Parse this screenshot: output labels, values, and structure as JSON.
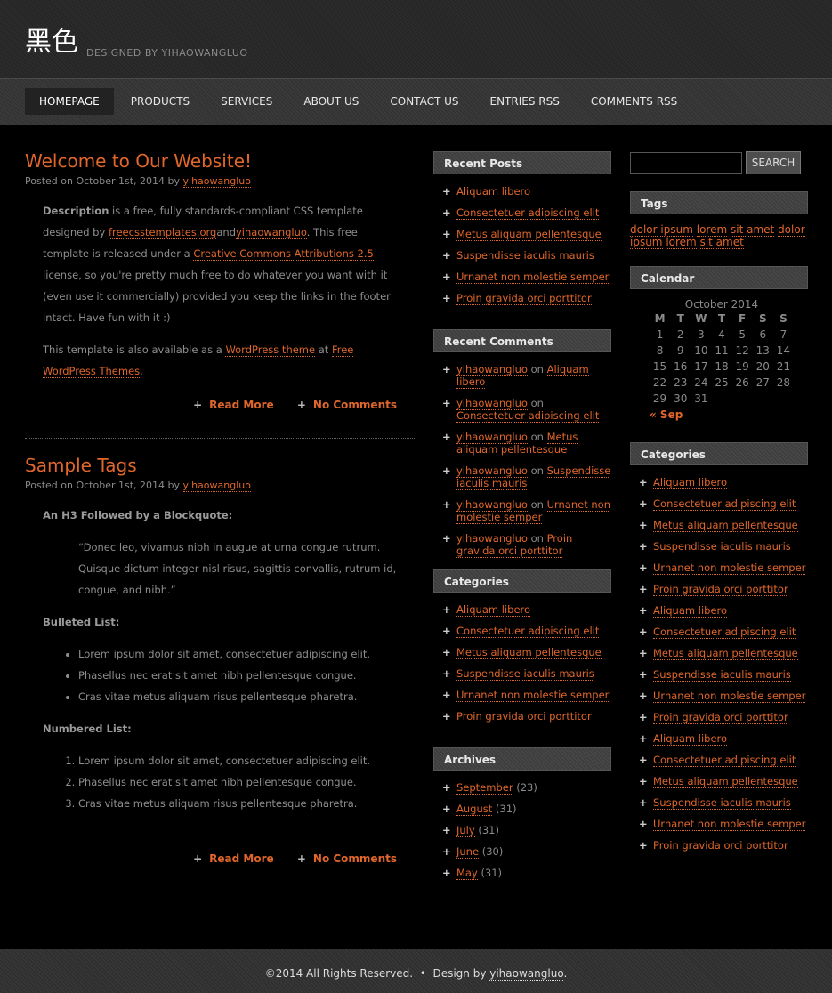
{
  "header": {
    "title": "黑色",
    "tagline": "DESIGNED BY YIHAOWANGLUO"
  },
  "menu": [
    {
      "label": "HOMEPAGE"
    },
    {
      "label": "PRODUCTS"
    },
    {
      "label": "SERVICES"
    },
    {
      "label": "ABOUT US"
    },
    {
      "label": "CONTACT US"
    },
    {
      "label": "ENTRIES RSS"
    },
    {
      "label": "COMMENTS RSS"
    }
  ],
  "posts": [
    {
      "title": "Welcome to Our Website!",
      "byline_prefix": "Posted on October 1st, 2014 by ",
      "author": "yihaowangluo",
      "p1": {
        "strong": "Description",
        "t1": " is a free, fully standards-compliant CSS template designed by ",
        "link1": "freecsstemplates.org",
        "t2": "and",
        "link2": "yihaowangluo",
        "t3": ". This free template is released under a ",
        "link3": "Creative Commons Attributions 2.5",
        "t4": " license, so you're pretty much free to do whatever you want with it (even use it commercially) provided you keep the links in the footer intact. Have fun with it :)"
      },
      "p2": {
        "t1": "This template is also available as a ",
        "link1": "WordPress theme",
        "t2": " at ",
        "link2": "Free WordPress Themes",
        "t3": "."
      },
      "read_more": "Read More",
      "comments": "No Comments"
    },
    {
      "title": "Sample Tags",
      "byline_prefix": "Posted on October 1st, 2014 by ",
      "author": "yihaowangluo",
      "h3_blockquote": "An H3 Followed by a Blockquote:",
      "blockquote": "“Donec leo, vivamus nibh in augue at urna congue rutrum. Quisque dictum integer nisl risus, sagittis convallis, rutrum id, congue, and nibh.”",
      "h3_bulleted": "Bulleted List:",
      "bulleted": [
        "Lorem ipsum dolor sit amet, consectetuer adipiscing elit.",
        "Phasellus nec erat sit amet nibh pellentesque congue.",
        "Cras vitae metus aliquam risus pellentesque pharetra."
      ],
      "h3_numbered": "Numbered List:",
      "numbered": [
        "Lorem ipsum dolor sit amet, consectetuer adipiscing elit.",
        "Phasellus nec erat sit amet nibh pellentesque congue.",
        "Cras vitae metus aliquam risus pellentesque pharetra."
      ],
      "read_more": "Read More",
      "comments": "No Comments"
    }
  ],
  "recent_posts": {
    "title": "Recent Posts",
    "items": [
      "Aliquam libero",
      "Consectetuer adipiscing elit",
      "Metus aliquam pellentesque",
      "Suspendisse iaculis mauris",
      "Urnanet non molestie semper",
      "Proin gravida orci porttitor"
    ]
  },
  "recent_comments": {
    "title": "Recent Comments",
    "on": "on",
    "items": [
      {
        "author": "yihaowangluo",
        "post": "Aliquam libero"
      },
      {
        "author": "yihaowangluo",
        "post": "Consectetuer adipiscing elit"
      },
      {
        "author": "yihaowangluo",
        "post": "Metus aliquam pellentesque"
      },
      {
        "author": "yihaowangluo",
        "post": "Suspendisse iaculis mauris"
      },
      {
        "author": "yihaowangluo",
        "post": "Urnanet non molestie semper"
      },
      {
        "author": "yihaowangluo",
        "post": "Proin gravida orci porttitor"
      }
    ]
  },
  "categories_mid": {
    "title": "Categories",
    "items": [
      "Aliquam libero",
      "Consectetuer adipiscing elit",
      "Metus aliquam pellentesque",
      "Suspendisse iaculis mauris",
      "Urnanet non molestie semper",
      "Proin gravida orci porttitor"
    ]
  },
  "archives": {
    "title": "Archives",
    "items": [
      {
        "month": "September",
        "count": "(23)"
      },
      {
        "month": "August",
        "count": "(31)"
      },
      {
        "month": "July",
        "count": "(31)"
      },
      {
        "month": "June",
        "count": "(30)"
      },
      {
        "month": "May",
        "count": "(31)"
      }
    ]
  },
  "search": {
    "placeholder": "",
    "button": "SEARCH"
  },
  "tags": {
    "title": "Tags",
    "items": [
      "dolor",
      "ipsum",
      "lorem",
      "sit amet",
      "dolor",
      "ipsum",
      "lorem",
      "sit amet"
    ]
  },
  "calendar": {
    "title": "Calendar",
    "caption": "October 2014",
    "days": [
      "M",
      "T",
      "W",
      "T",
      "F",
      "S",
      "S"
    ],
    "weeks": [
      [
        "1",
        "2",
        "3",
        "4",
        "5",
        "6",
        "7"
      ],
      [
        "8",
        "9",
        "10",
        "11",
        "12",
        "13",
        "14"
      ],
      [
        "15",
        "16",
        "17",
        "18",
        "19",
        "20",
        "21"
      ],
      [
        "22",
        "23",
        "24",
        "25",
        "26",
        "27",
        "28"
      ],
      [
        "29",
        "30",
        "31",
        "",
        "",
        "",
        ""
      ]
    ],
    "prev": "« Sep"
  },
  "categories_right": {
    "title": "Categories",
    "items": [
      "Aliquam libero",
      "Consectetuer adipiscing elit",
      "Metus aliquam pellentesque",
      "Suspendisse iaculis mauris",
      "Urnanet non molestie semper",
      "Proin gravida orci porttitor",
      "Aliquam libero",
      "Consectetuer adipiscing elit",
      "Metus aliquam pellentesque",
      "Suspendisse iaculis mauris",
      "Urnanet non molestie semper",
      "Proin gravida orci porttitor",
      "Aliquam libero",
      "Consectetuer adipiscing elit",
      "Metus aliquam pellentesque",
      "Suspendisse iaculis mauris",
      "Urnanet non molestie semper",
      "Proin gravida orci porttitor"
    ]
  },
  "footer": {
    "copyright": "©2014 All Rights Reserved.",
    "bullet": "•",
    "design_by": "Design by",
    "designer": "yihaowangluo",
    "period": "."
  }
}
